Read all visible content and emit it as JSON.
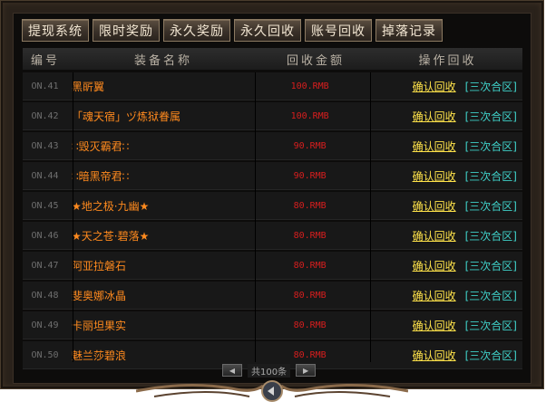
{
  "tabs": [
    "提现系统",
    "限时奖励",
    "永久奖励",
    "永久回收",
    "账号回收",
    "掉落记录"
  ],
  "header": {
    "no": "编号",
    "name": "装备名称",
    "amount": "回收金额",
    "op": "操作回收"
  },
  "rows": [
    {
      "no": "ON.41",
      "name": "黑㪽翼",
      "amount": "100.RMB",
      "confirm": "确认回收",
      "zone": "[三次合区]"
    },
    {
      "no": "ON.42",
      "name": "「魂天宿」ヅ炼狱眷属",
      "amount": "100.RMB",
      "confirm": "确认回收",
      "zone": "[三次合区]"
    },
    {
      "no": "ON.43",
      "name": "∷毁灭霸君∷",
      "amount": "90.RMB",
      "confirm": "确认回收",
      "zone": "[三次合区]"
    },
    {
      "no": "ON.44",
      "name": "∷暗黑帝君∷",
      "amount": "90.RMB",
      "confirm": "确认回收",
      "zone": "[三次合区]"
    },
    {
      "no": "ON.45",
      "name": "★地之极·九幽★",
      "amount": "80.RMB",
      "confirm": "确认回收",
      "zone": "[三次合区]"
    },
    {
      "no": "ON.46",
      "name": "★天之苍·碧落★",
      "amount": "80.RMB",
      "confirm": "确认回收",
      "zone": "[三次合区]"
    },
    {
      "no": "ON.47",
      "name": "阿亚拉磐石",
      "amount": "80.RMB",
      "confirm": "确认回收",
      "zone": "[三次合区]"
    },
    {
      "no": "ON.48",
      "name": "斐奥娜冰晶",
      "amount": "80.RMB",
      "confirm": "确认回收",
      "zone": "[三次合区]"
    },
    {
      "no": "ON.49",
      "name": "卡丽坦果实",
      "amount": "80.RMB",
      "confirm": "确认回收",
      "zone": "[三次合区]"
    },
    {
      "no": "ON.50",
      "name": "魅兰莎碧浪",
      "amount": "80.RMB",
      "confirm": "确认回收",
      "zone": "[三次合区]"
    }
  ],
  "pager": {
    "prev_icon": "arrow-left-icon",
    "text": "共100条",
    "next_icon": "arrow-right-icon"
  },
  "colors": {
    "item_name": "#ff8a1e",
    "amount": "#d81e1e",
    "confirm": "#ffe34a",
    "zone": "#3fd0c8"
  }
}
